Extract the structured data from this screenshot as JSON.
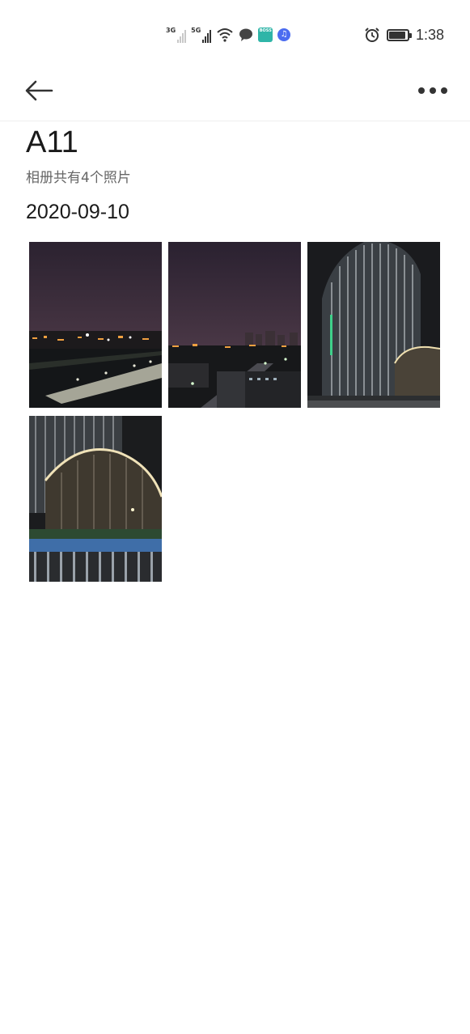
{
  "status_bar": {
    "network1": "3G",
    "network2": "5G",
    "boss_app_label": "BOSS",
    "time": "1:38",
    "battery_level": 0.9,
    "icons": [
      "signal-3g-icon",
      "signal-5g-icon",
      "wifi-icon",
      "chat-bubble-icon",
      "boss-app-icon",
      "music-app-icon",
      "alarm-icon",
      "battery-icon"
    ]
  },
  "app_bar": {
    "back_icon": "arrow-left-icon",
    "more_icon": "more-horizontal-icon"
  },
  "album": {
    "title": "A11",
    "count_text": "相册共有4个照片"
  },
  "groups": [
    {
      "date": "2020-09-10",
      "photos": [
        {
          "scene": "night-cityscape-wide"
        },
        {
          "scene": "night-cityscape-street"
        },
        {
          "scene": "night-office-tower"
        },
        {
          "scene": "night-building-with-railing"
        }
      ]
    }
  ]
}
